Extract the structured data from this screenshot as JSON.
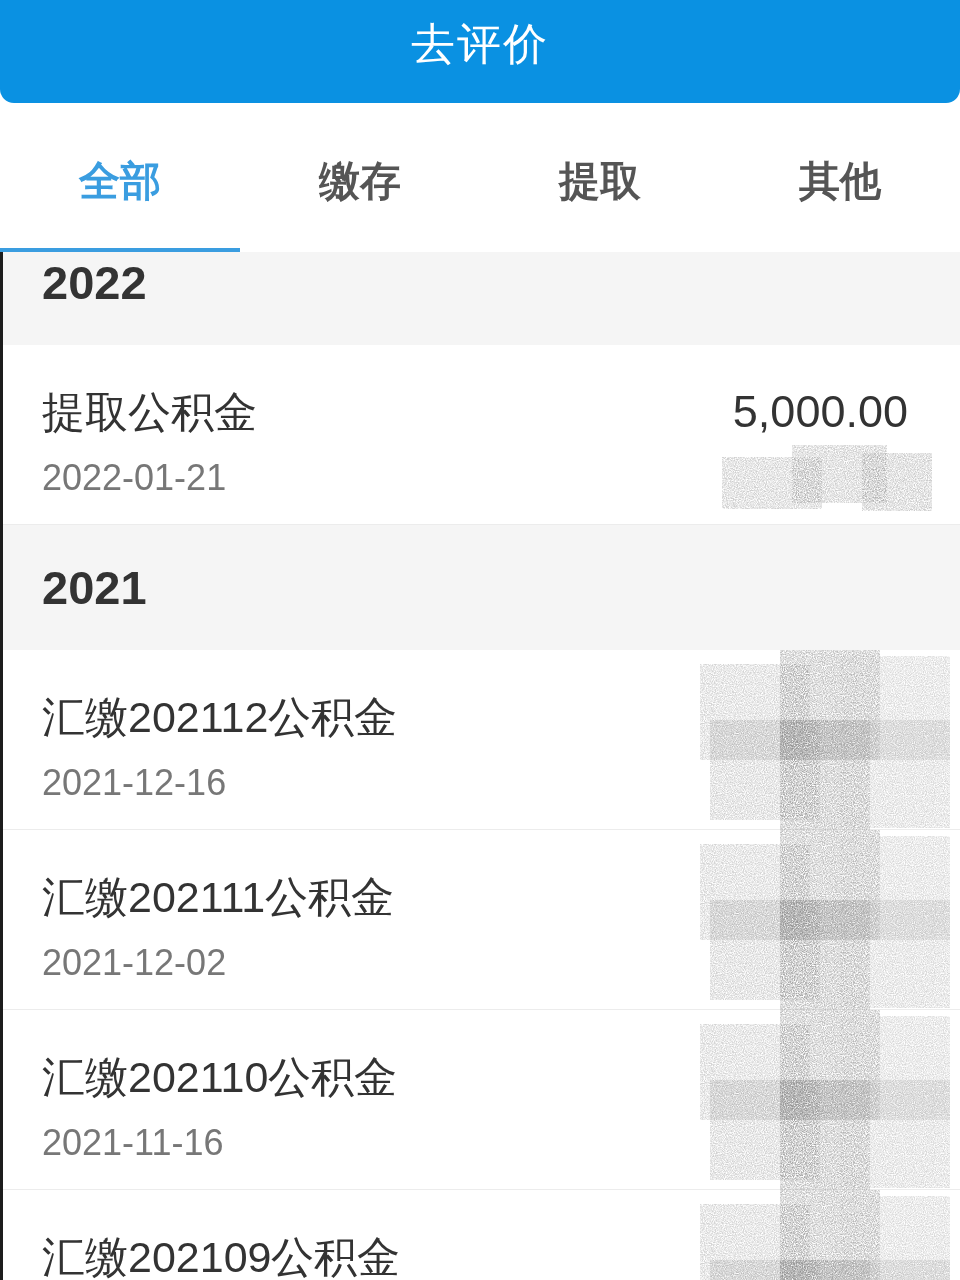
{
  "header_button": {
    "label": "去评价"
  },
  "tabs": [
    {
      "label": "全部",
      "selected": true
    },
    {
      "label": "缴存",
      "selected": false
    },
    {
      "label": "提取",
      "selected": false
    },
    {
      "label": "其他",
      "selected": false
    }
  ],
  "groups": [
    {
      "year": "2022",
      "records": [
        {
          "title": "提取公积金",
          "date": "2022-01-21",
          "amount": "5,000.00",
          "amount_scribbled": false,
          "balance_scribbled": true
        }
      ]
    },
    {
      "year": "2021",
      "records": [
        {
          "title": "汇缴202112公积金",
          "date": "2021-12-16",
          "amount_scribbled": true,
          "balance_scribbled": true
        },
        {
          "title": "汇缴202111公积金",
          "date": "2021-12-02",
          "amount_scribbled": true,
          "balance_scribbled": true
        },
        {
          "title": "汇缴202110公积金",
          "date": "2021-11-16",
          "amount_scribbled": true,
          "balance_scribbled": true
        },
        {
          "title": "汇缴202109公积金",
          "amount_scribbled": true,
          "balance_scribbled": true
        }
      ]
    }
  ]
}
